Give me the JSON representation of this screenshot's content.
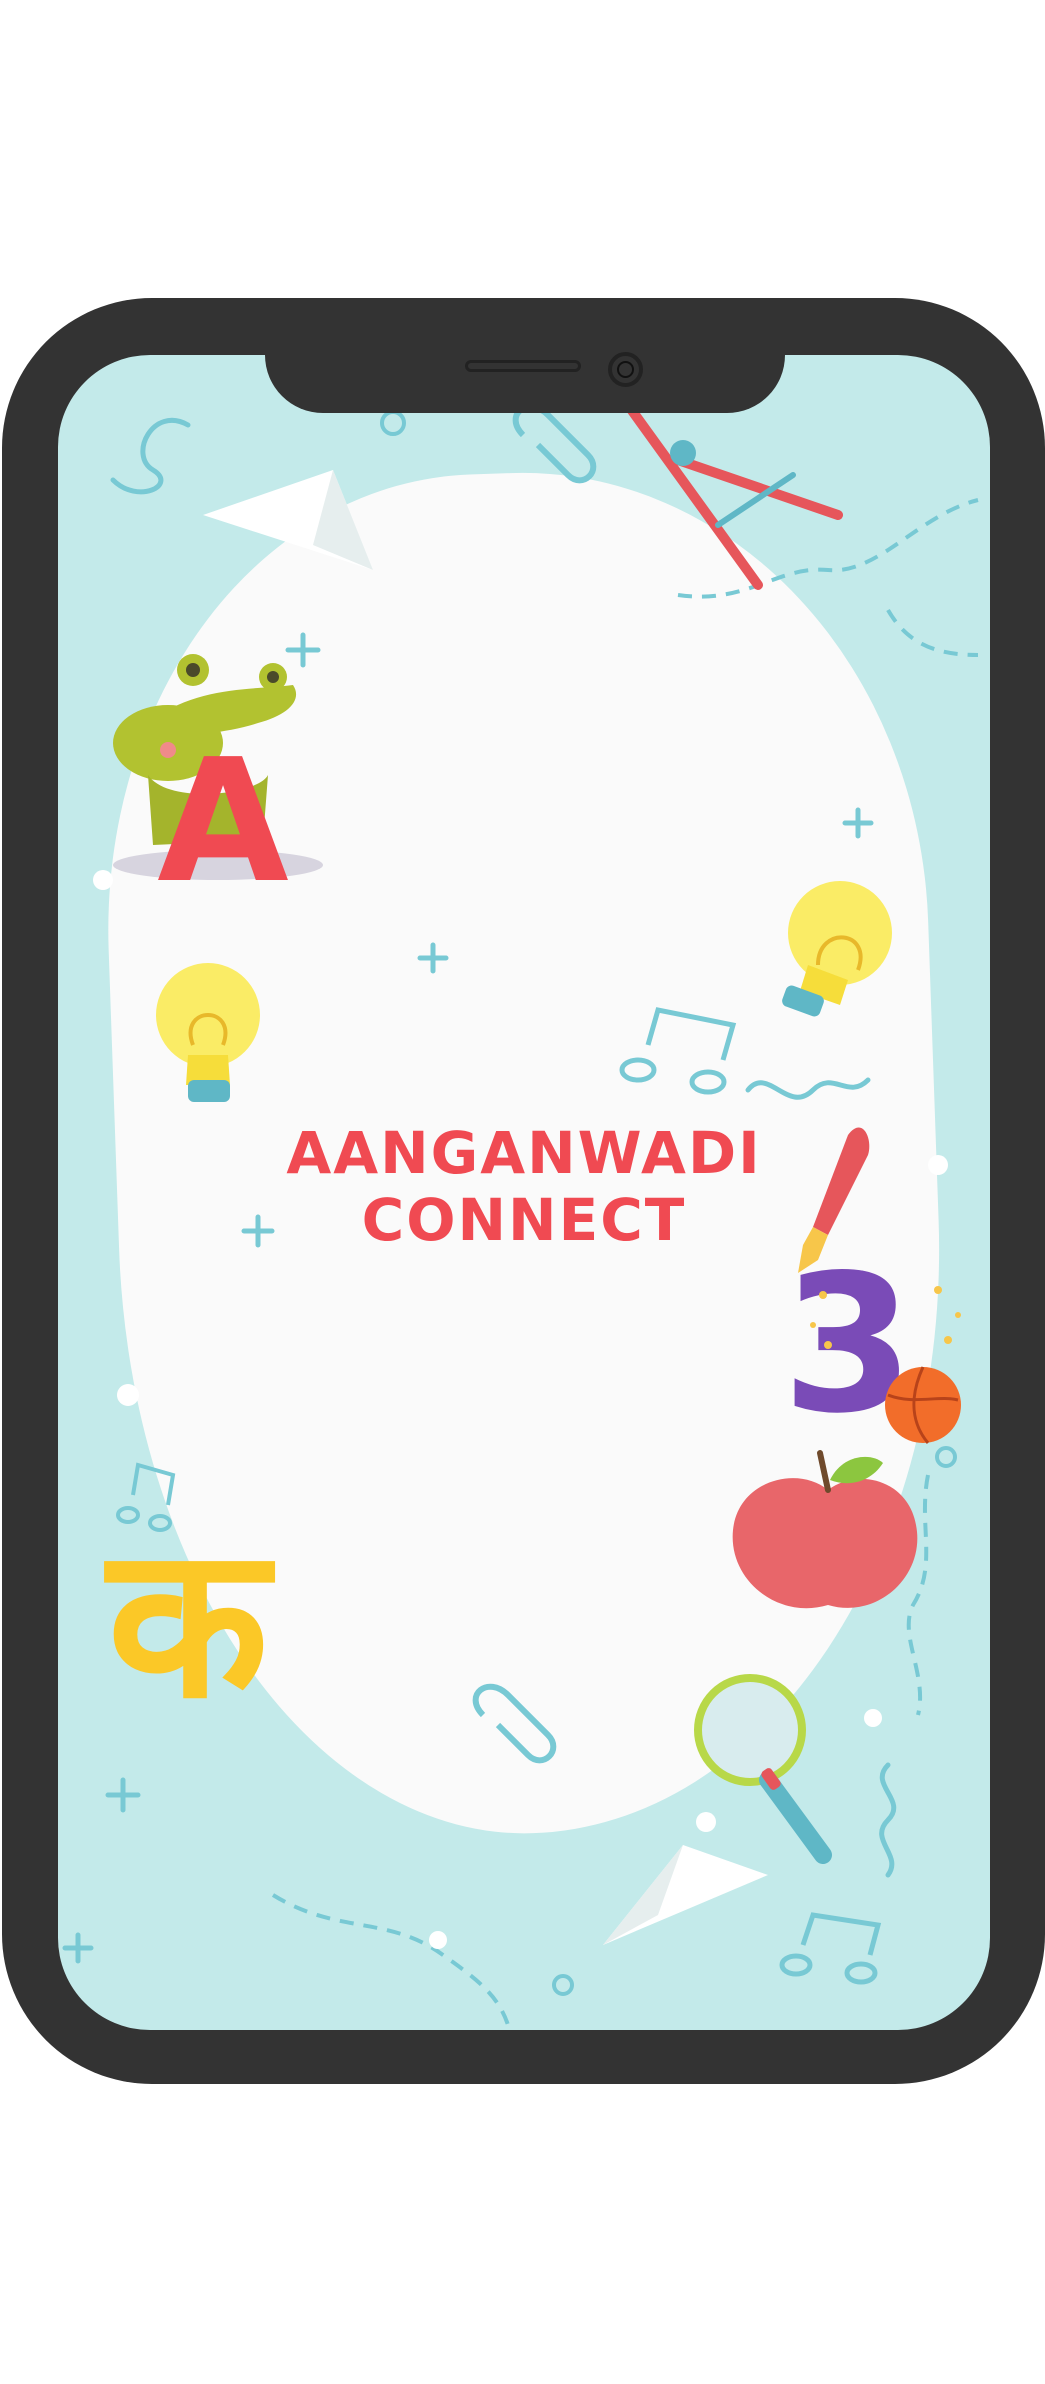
{
  "splash": {
    "title_line1": "AANGANWADI",
    "title_line2": "CONNECT",
    "hindi_letter": "क",
    "letter_a": "A",
    "number_three": "3"
  },
  "colors": {
    "title": "#f04a52",
    "screen_background": "#c3eaea",
    "phone_frame": "#333333",
    "blob": "#fafafa",
    "hindi_letter": "#fbc827",
    "letter_a": "#f04a52",
    "number_three": "#7a4bb7"
  },
  "icons": [
    "crocodile-icon",
    "paper-plane-icon",
    "compass-icon",
    "paperclip-icon",
    "lightbulb-icon",
    "music-note-icon",
    "paintbrush-icon",
    "basketball-icon",
    "apple-icon",
    "magnifying-glass-icon"
  ]
}
